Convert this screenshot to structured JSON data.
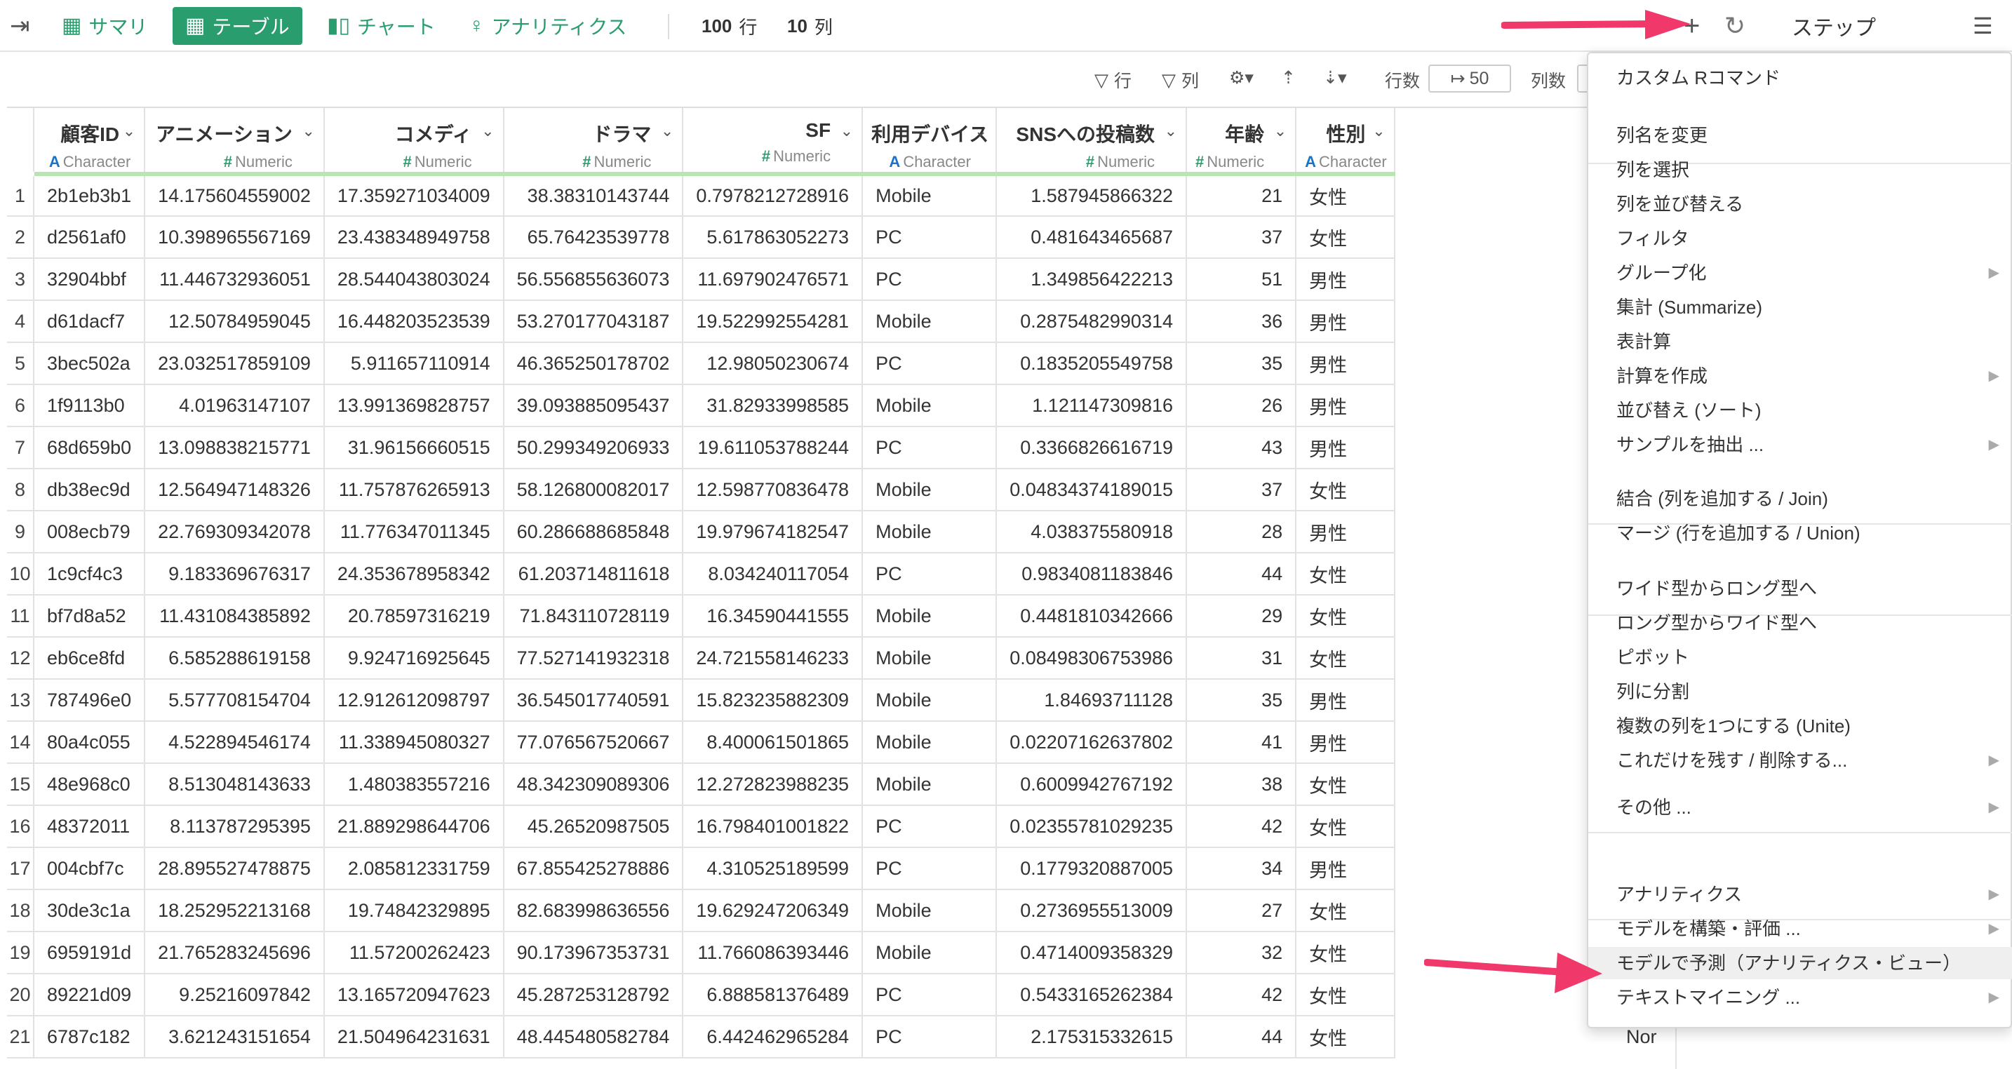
{
  "topbar": {
    "summary": "サマリ",
    "table": "テーブル",
    "chart": "チャート",
    "analytics": "アナリティクス",
    "rows_count": "100",
    "rows_unit": "行",
    "cols_count": "10",
    "cols_unit": "列",
    "steps": "ステップ"
  },
  "toolbar2": {
    "filter_row": "行",
    "filter_col": "列",
    "row_count_label": "行数",
    "row_count_value": "50",
    "col_count_label": "列数"
  },
  "columns": [
    {
      "name": "顧客ID",
      "type": "Character",
      "kind": "char"
    },
    {
      "name": "アニメーション",
      "type": "Numeric",
      "kind": "num"
    },
    {
      "name": "コメディ",
      "type": "Numeric",
      "kind": "num"
    },
    {
      "name": "ドラマ",
      "type": "Numeric",
      "kind": "num"
    },
    {
      "name": "SF",
      "type": "Numeric",
      "kind": "num"
    },
    {
      "name": "利用デバイス",
      "type": "Character",
      "kind": "char"
    },
    {
      "name": "SNSへの投稿数",
      "type": "Numeric",
      "kind": "num"
    },
    {
      "name": "年齢",
      "type": "Numeric",
      "kind": "num"
    },
    {
      "name": "性別",
      "type": "Character",
      "kind": "char"
    }
  ],
  "rows": [
    [
      "1",
      "2b1eb3b1",
      "14.175604559002",
      "17.359271034009",
      "38.38310143744",
      "0.7978212728916",
      "Mobile",
      "1.587945866322",
      "21",
      "女性"
    ],
    [
      "2",
      "d2561af0",
      "10.398965567169",
      "23.438348949758",
      "65.76423539778",
      "5.617863052273",
      "PC",
      "0.481643465687",
      "37",
      "女性"
    ],
    [
      "3",
      "32904bbf",
      "11.446732936051",
      "28.544043803024",
      "56.556855636073",
      "11.697902476571",
      "PC",
      "1.349856422213",
      "51",
      "男性"
    ],
    [
      "4",
      "d61dacf7",
      "12.50784959045",
      "16.448203523539",
      "53.270177043187",
      "19.522992554281",
      "Mobile",
      "0.2875482990314",
      "36",
      "男性"
    ],
    [
      "5",
      "3bec502a",
      "23.032517859109",
      "5.911657110914",
      "46.365250178702",
      "12.98050230674",
      "PC",
      "0.1835205549758",
      "35",
      "男性"
    ],
    [
      "6",
      "1f9113b0",
      "4.01963147107",
      "13.991369828757",
      "39.093885095437",
      "31.82933998585",
      "Mobile",
      "1.121147309816",
      "26",
      "男性"
    ],
    [
      "7",
      "68d659b0",
      "13.098838215771",
      "31.96156660515",
      "50.299349206933",
      "19.611053788244",
      "PC",
      "0.3366826616719",
      "43",
      "男性"
    ],
    [
      "8",
      "db38ec9d",
      "12.564947148326",
      "11.757876265913",
      "58.126800082017",
      "12.598770836478",
      "Mobile",
      "0.04834374189015",
      "37",
      "女性"
    ],
    [
      "9",
      "008ecb79",
      "22.769309342078",
      "11.776347011345",
      "60.286688685848",
      "19.979674182547",
      "Mobile",
      "4.038375580918",
      "28",
      "男性"
    ],
    [
      "10",
      "1c9cf4c3",
      "9.183369676317",
      "24.353678958342",
      "61.203714811618",
      "8.034240117054",
      "PC",
      "0.9834081183846",
      "44",
      "女性"
    ],
    [
      "11",
      "bf7d8a52",
      "11.431084385892",
      "20.78597316219",
      "71.843110728119",
      "16.34590441555",
      "Mobile",
      "0.4481810342666",
      "29",
      "女性"
    ],
    [
      "12",
      "eb6ce8fd",
      "6.585288619158",
      "9.924716925645",
      "77.527141932318",
      "24.721558146233",
      "Mobile",
      "0.08498306753986",
      "31",
      "女性"
    ],
    [
      "13",
      "787496e0",
      "5.577708154704",
      "12.912612098797",
      "36.545017740591",
      "15.823235882309",
      "Mobile",
      "1.84693711128",
      "35",
      "男性"
    ],
    [
      "14",
      "80a4c055",
      "4.522894546174",
      "11.338945080327",
      "77.076567520667",
      "8.400061501865",
      "Mobile",
      "0.02207162637802",
      "41",
      "男性"
    ],
    [
      "15",
      "48e968c0",
      "8.513048143633",
      "1.480383557216",
      "48.342309089306",
      "12.272823988235",
      "Mobile",
      "0.6009942767192",
      "38",
      "女性"
    ],
    [
      "16",
      "48372011",
      "8.113787295395",
      "21.889298644706",
      "45.26520987505",
      "16.798401001822",
      "PC",
      "0.02355781029235",
      "42",
      "女性"
    ],
    [
      "17",
      "004cbf7c",
      "28.895527478875",
      "2.085812331759",
      "67.855425278886",
      "4.310525189599",
      "PC",
      "0.1779320887005",
      "34",
      "男性"
    ],
    [
      "18",
      "30de3c1a",
      "18.252952213168",
      "19.74842329895",
      "82.683998636556",
      "19.629247206349",
      "Mobile",
      "0.2736955513009",
      "27",
      "女性"
    ],
    [
      "19",
      "6959191d",
      "21.765283245696",
      "11.57200262423",
      "90.173967353731",
      "11.766086393446",
      "Mobile",
      "0.4714009358329",
      "32",
      "女性"
    ],
    [
      "20",
      "89221d09",
      "9.25216097842",
      "13.165720947623",
      "45.287253128792",
      "6.888581376489",
      "PC",
      "0.5433165262384",
      "42",
      "女性"
    ],
    [
      "21",
      "6787c182",
      "3.621243151654",
      "21.504964231631",
      "48.445480582784",
      "6.442462965284",
      "PC",
      "2.175315332615",
      "44",
      "女性"
    ]
  ],
  "row21_extra": "Nor",
  "menu": {
    "group1": [
      "カスタム Rコマンド"
    ],
    "group2": [
      "列名を変更",
      "列を選択",
      "列を並び替える",
      "フィルタ",
      "グループ化",
      "集計 (Summarize)",
      "表計算",
      "計算を作成",
      "並び替え (ソート)",
      "サンプルを抽出 ..."
    ],
    "group3": [
      "結合 (列を追加する / Join)",
      "マージ (行を追加する / Union)"
    ],
    "group4": [
      "ワイド型からロング型へ",
      "ロング型からワイド型へ",
      "ピボット",
      "列に分割",
      "複数の列を1つにする (Unite)",
      "これだけを残す / 削除する..."
    ],
    "group5": [
      "その他 ..."
    ],
    "group6": [
      "アナリティクス",
      "モデルを構築・評価 ...",
      "モデルで予測（アナリティクス・ビュー）",
      "テキストマイニング ..."
    ]
  },
  "colors": {
    "accent": "#2a9d6e",
    "type_char": "#1a73c9",
    "header_underline": "#b8e6b1",
    "annotation_arrow": "#f0386b"
  }
}
